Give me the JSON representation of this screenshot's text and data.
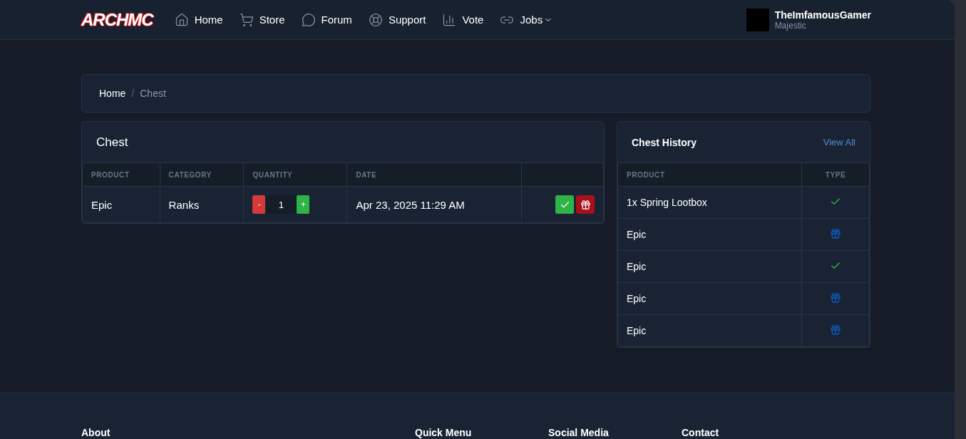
{
  "navbar": {
    "logo": "ARCHMC",
    "links": [
      {
        "label": "Home",
        "dropdown": false
      },
      {
        "label": "Store",
        "dropdown": false
      },
      {
        "label": "Forum",
        "dropdown": false
      },
      {
        "label": "Support",
        "dropdown": false
      },
      {
        "label": "Vote",
        "dropdown": false
      },
      {
        "label": "Jobs",
        "dropdown": true
      }
    ],
    "user": {
      "name": "TheImfamousGamer",
      "rank": "Majestic"
    }
  },
  "breadcrumb": [
    {
      "label": "Home",
      "current": false
    },
    {
      "label": "Chest",
      "current": true
    }
  ],
  "breadcrumb_separator": "/",
  "chest": {
    "title": "Chest",
    "columns": [
      "PRODUCT",
      "CATEGORY",
      "QUANTITY",
      "DATE"
    ],
    "rows": [
      {
        "product": "Epic",
        "category": "Ranks",
        "quantity": "1",
        "minus": "-",
        "plus": "+",
        "date": "Apr 23, 2025 11:29 AM"
      }
    ]
  },
  "history": {
    "title": "Chest History",
    "view_all": "View All",
    "columns": [
      "PRODUCT",
      "TYPE"
    ],
    "rows": [
      {
        "product": "1x Spring Lootbox",
        "kind": "claimed"
      },
      {
        "product": "Epic",
        "kind": "gift"
      },
      {
        "product": "Epic",
        "kind": "claimed"
      },
      {
        "product": "Epic",
        "kind": "gift"
      },
      {
        "product": "Epic",
        "kind": "gift"
      }
    ]
  },
  "footer": {
    "headings": [
      "About",
      "Quick Menu",
      "Social Media",
      "Contact"
    ]
  }
}
